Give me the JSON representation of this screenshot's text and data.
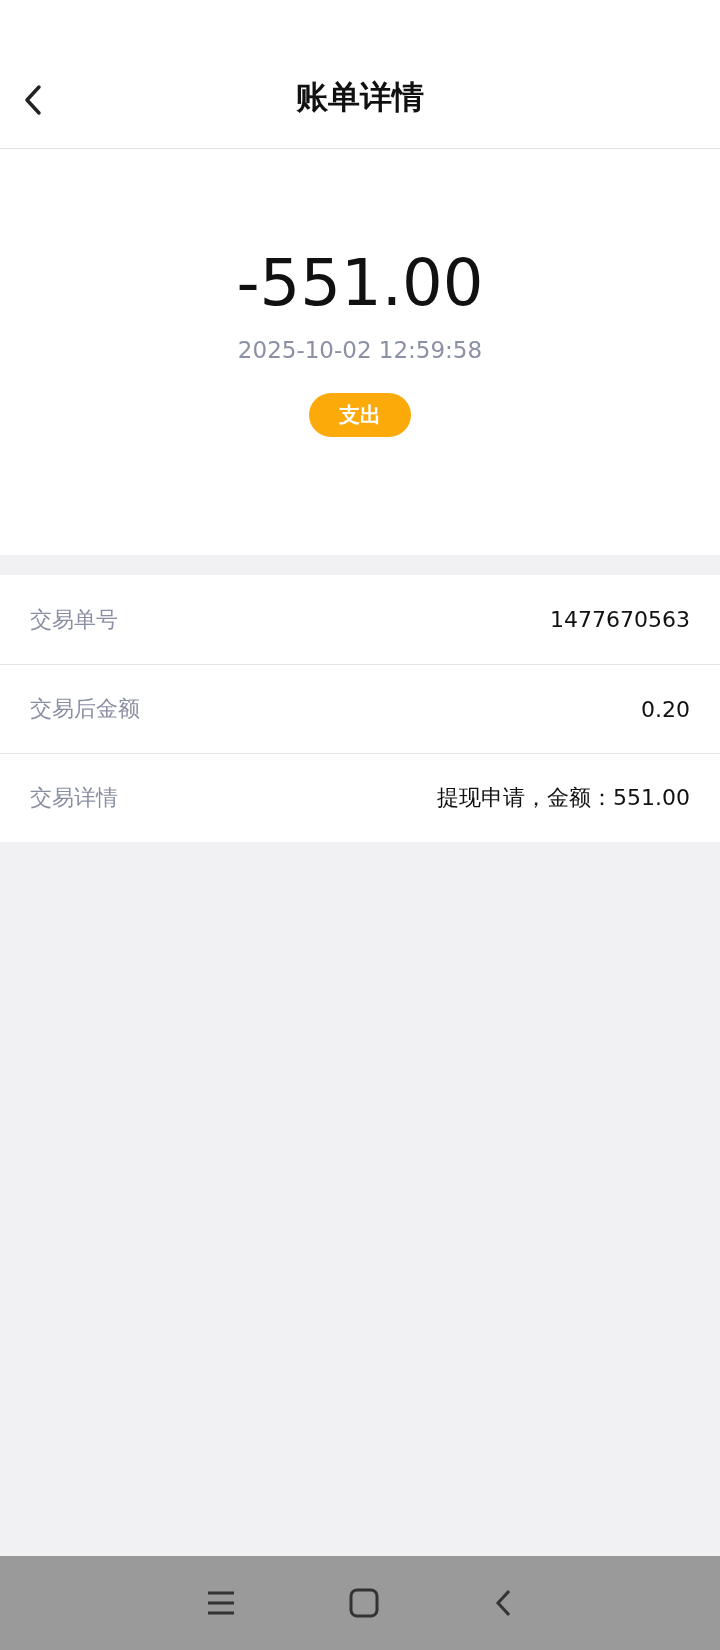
{
  "header": {
    "title": "账单详情"
  },
  "summary": {
    "amount": "-551.00",
    "time": "2025-10-02 12:59:58",
    "type": "支出"
  },
  "details": [
    {
      "label": "交易单号",
      "value": "1477670563"
    },
    {
      "label": "交易后金额",
      "value": "0.20"
    },
    {
      "label": "交易详情",
      "value": "提现申请，金额：551.00"
    }
  ]
}
